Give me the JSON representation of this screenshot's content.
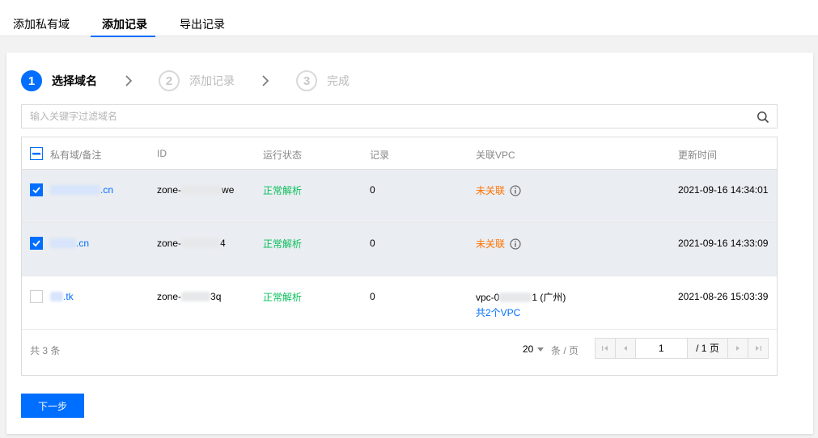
{
  "tabs": [
    {
      "label": "添加私有域",
      "active": false
    },
    {
      "label": "添加记录",
      "active": true
    },
    {
      "label": "导出记录",
      "active": false
    }
  ],
  "steps": [
    {
      "num": "1",
      "label": "选择域名",
      "active": true
    },
    {
      "num": "2",
      "label": "添加记录",
      "active": false
    },
    {
      "num": "3",
      "label": "完成",
      "active": false
    }
  ],
  "search": {
    "placeholder": "输入关键字过滤域名",
    "value": ""
  },
  "table": {
    "columns": [
      "私有域/备注",
      "ID",
      "运行状态",
      "记录",
      "关联VPC",
      "更新时间"
    ],
    "rows": [
      {
        "checked": true,
        "domain_suffix": ".cn",
        "id_prefix": "zone-",
        "id_suffix": "we",
        "status": "正常解析",
        "records": "0",
        "vpc": "未关联",
        "updated": "2021-09-16 14:34:01"
      },
      {
        "checked": true,
        "domain_suffix": ".cn",
        "id_prefix": "zone-",
        "id_suffix": "4",
        "status": "正常解析",
        "records": "0",
        "vpc": "未关联",
        "updated": "2021-09-16 14:33:09"
      },
      {
        "checked": false,
        "domain_suffix": ".tk",
        "id_prefix": "zone-",
        "id_suffix": "3q",
        "status": "正常解析",
        "records": "0",
        "vpc_prefix": "vpc-0",
        "vpc_suffix": "1 (广州)",
        "vpc_more": "共2个VPC",
        "updated": "2021-08-26 15:03:39"
      }
    ]
  },
  "footer": {
    "total": "共 3 条",
    "page_size": "20",
    "per_page_label": "条 / 页",
    "current_page": "1",
    "total_pages": "/ 1 页"
  },
  "next_button": "下一步",
  "colors": {
    "primary": "#006eff",
    "success": "#0abf5b",
    "warning": "#ff7200"
  }
}
